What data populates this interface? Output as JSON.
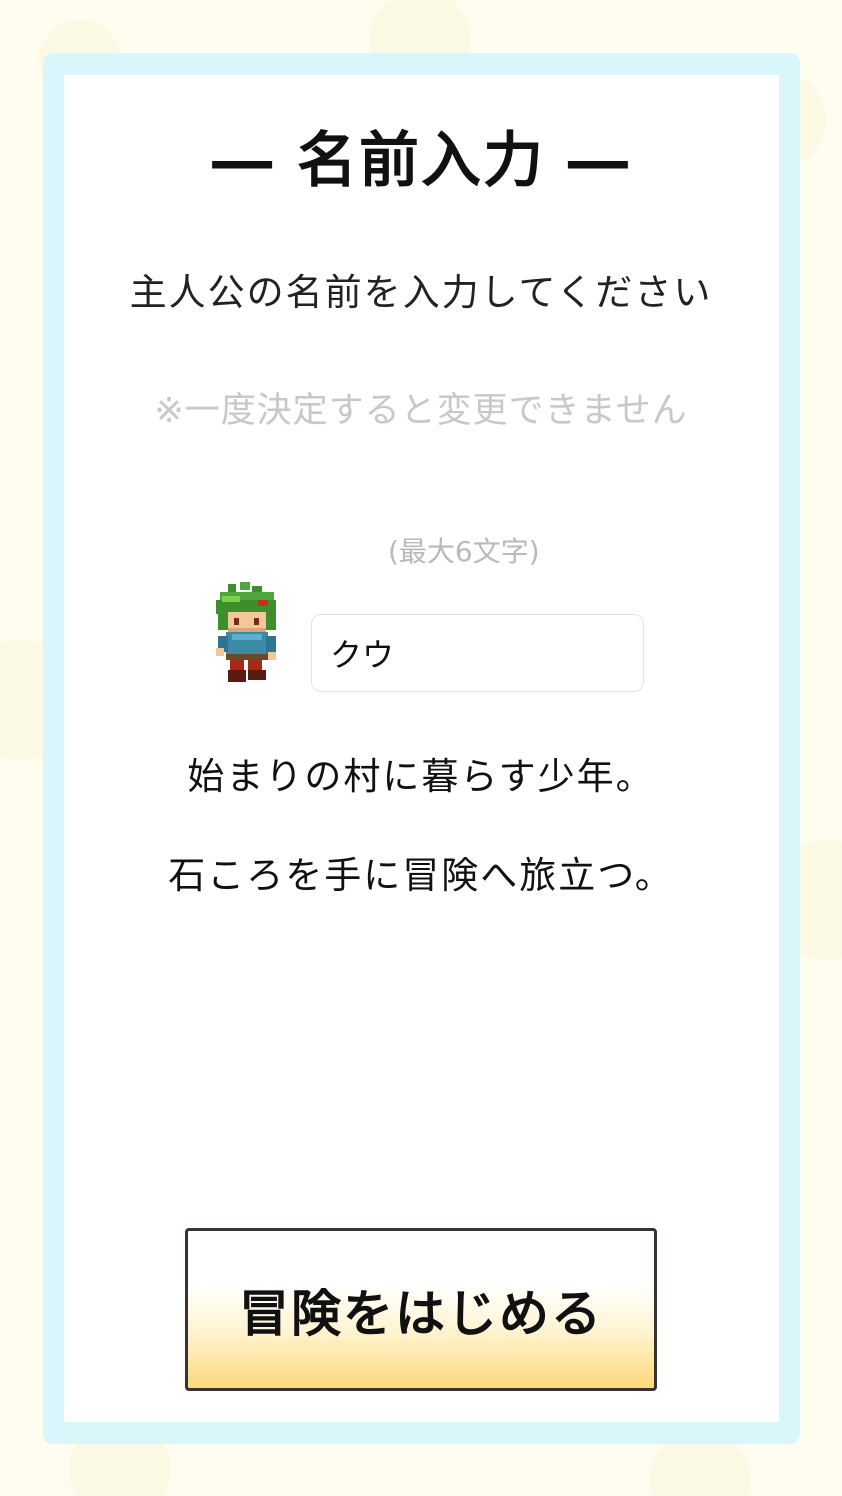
{
  "header": {
    "title": "― 名前入力 ―"
  },
  "form": {
    "prompt": "主人公の名前を入力してください",
    "warning": "※一度決定すると変更できません",
    "max_length_note": "(最大6文字)",
    "name_value": "クウ"
  },
  "character": {
    "description_line1": "始まりの村に暮らす少年。",
    "description_line2": "石ころを手に冒険へ旅立つ。"
  },
  "actions": {
    "start_label": "冒険をはじめる"
  },
  "colors": {
    "frame": "#d9f7fb",
    "button_gradient_end": "#fcd97a",
    "hint_text": "#c7c7cc"
  }
}
